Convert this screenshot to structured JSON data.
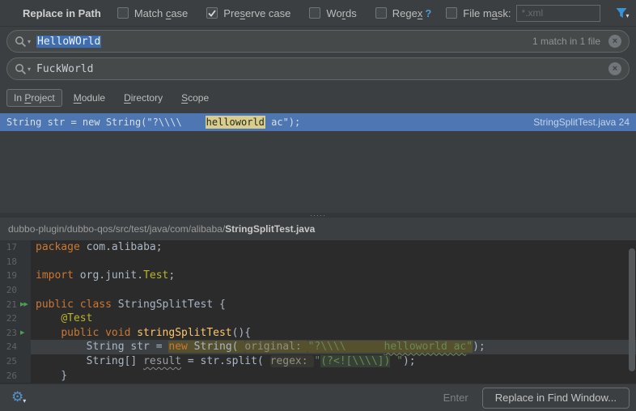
{
  "header": {
    "title": "Replace in Path",
    "checkboxes": [
      {
        "pre": "Match ",
        "m": "c",
        "post": "ase",
        "checked": false
      },
      {
        "pre": "Pre",
        "m": "s",
        "post": "erve case",
        "checked": true
      },
      {
        "pre": "Wo",
        "m": "r",
        "post": "ds",
        "checked": false
      },
      {
        "pre": "Rege",
        "m": "x",
        "post": "",
        "checked": false
      },
      {
        "pre": "File m",
        "m": "a",
        "post": "sk:",
        "checked": false
      }
    ],
    "regex_help": "?",
    "file_mask_placeholder": "*.xml"
  },
  "search": {
    "value": "HelloWOrld",
    "result_count": "1 match in 1 file"
  },
  "replace": {
    "value": "FuckWorld"
  },
  "scope_tabs": [
    {
      "pre": "In ",
      "m": "P",
      "post": "roject",
      "active": true
    },
    {
      "pre": "",
      "m": "M",
      "post": "odule",
      "active": false
    },
    {
      "pre": "",
      "m": "D",
      "post": "irectory",
      "active": false
    },
    {
      "pre": "",
      "m": "S",
      "post": "cope",
      "active": false
    }
  ],
  "result": {
    "prefix": "String str = new String(\"?\\\\\\\\    ",
    "match": "helloworld",
    "suffix": " ac\");",
    "file_ref": "StringSplitTest.java 24"
  },
  "breadcrumb": {
    "path": "dubbo-plugin/dubbo-qos/src/test/java/com/alibaba/",
    "file": "StringSplitTest.java"
  },
  "editor": {
    "lines": [
      {
        "no": "17",
        "tokens": [
          {
            "t": "package",
            "c": "kw"
          },
          {
            "t": " com.alibaba;",
            "c": "pl"
          }
        ]
      },
      {
        "no": "18",
        "tokens": []
      },
      {
        "no": "19",
        "tokens": [
          {
            "t": "import",
            "c": "kw"
          },
          {
            "t": " org.junit.",
            "c": "pl"
          },
          {
            "t": "Test",
            "c": "ann"
          },
          {
            "t": ";",
            "c": "pl"
          }
        ]
      },
      {
        "no": "20",
        "tokens": []
      },
      {
        "no": "21",
        "icon": "run_class",
        "tokens": [
          {
            "t": "public class ",
            "c": "kw"
          },
          {
            "t": "StringSplitTest {",
            "c": "pl"
          }
        ]
      },
      {
        "no": "22",
        "tokens": [
          {
            "t": "    ",
            "c": "pl"
          },
          {
            "t": "@Test",
            "c": "ann"
          }
        ]
      },
      {
        "no": "23",
        "icon": "run_method",
        "tokens": [
          {
            "t": "    ",
            "c": "pl"
          },
          {
            "t": "public void ",
            "c": "kw"
          },
          {
            "t": "stringSplitTest",
            "c": "mth"
          },
          {
            "t": "(){",
            "c": "pl"
          }
        ]
      },
      {
        "no": "24",
        "row_hl": true,
        "tokens": [
          {
            "t": "        String str = ",
            "c": "pl"
          },
          {
            "t": "new",
            "c": "kw",
            "bg": "match"
          },
          {
            "t": " String( ",
            "c": "pl",
            "bg": "match"
          },
          {
            "t": "original: ",
            "c": "hint",
            "bg": "match"
          },
          {
            "t": "\"?\\\\\\\\      ",
            "c": "str",
            "bg": "match"
          },
          {
            "t": "helloworld ac",
            "c": "str",
            "bg": "match",
            "wavy": true
          },
          {
            "t": "\"",
            "c": "str",
            "bg": "match"
          },
          {
            "t": ");",
            "c": "pl"
          }
        ]
      },
      {
        "no": "25",
        "tokens": [
          {
            "t": "        String[] ",
            "c": "pl"
          },
          {
            "t": "result",
            "c": "unused",
            "wavy": true
          },
          {
            "t": " = str.split( ",
            "c": "pl"
          },
          {
            "t": "regex: ",
            "c": "hint"
          },
          {
            "t": "\"",
            "c": "str"
          },
          {
            "t": "(?<![\\\\\\\\])",
            "c": "str",
            "bg": "frag"
          },
          {
            "t": " \"",
            "c": "str"
          },
          {
            "t": ");",
            "c": "pl"
          }
        ]
      },
      {
        "no": "26",
        "tokens": [
          {
            "t": "    }",
            "c": "pl"
          }
        ]
      }
    ]
  },
  "footer": {
    "enter_hint": "Enter",
    "button": "Replace in Find Window..."
  },
  "icons": {
    "dropdown_arrow": "▾",
    "close": "×",
    "gear": "⚙",
    "splitter_dots": "·····",
    "run_class": "▶▶",
    "run_method": "▶"
  },
  "colors": {
    "selection_blue": "#4e76b2",
    "field_selection": "#3f6daf",
    "result_match_highlight": "#d8cd8d",
    "editor_match_highlight": "#55512e",
    "accent_blue": "#3a93d6",
    "keyword_orange": "#cc7832",
    "string_green": "#6a8759"
  }
}
